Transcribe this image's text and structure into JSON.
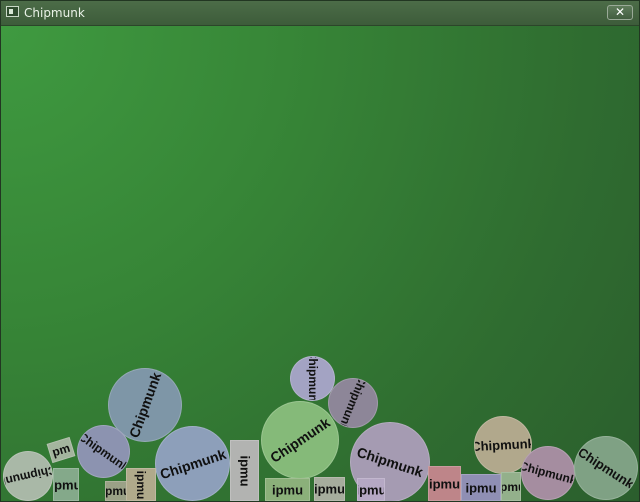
{
  "window": {
    "title": "Chipmunk",
    "close_symbol": "✕"
  },
  "scene": {
    "body_text": "Chipmunk",
    "palette": {
      "bg_top": "#3f9a40",
      "bg_bottom": "#2b5e2d"
    },
    "bodies": [
      {
        "name": "body-circle-1",
        "shape": "circle",
        "text": "Chipmunk",
        "color": "#a9b8a7"
      },
      {
        "name": "body-circle-2",
        "shape": "circle",
        "text": "Chipmunk",
        "color": "#7e96a7"
      },
      {
        "name": "body-circle-3",
        "shape": "circle",
        "text": "Chipmunk",
        "color": "#8c93b0"
      },
      {
        "name": "body-circle-4",
        "shape": "circle",
        "text": "Chipmunk",
        "color": "#8d9fba"
      },
      {
        "name": "body-circle-5",
        "shape": "circle",
        "text": "Chipmunk",
        "color": "#a3a3c3"
      },
      {
        "name": "body-circle-6",
        "shape": "circle",
        "text": "Chipmunk",
        "color": "#8d8698"
      },
      {
        "name": "body-circle-7",
        "shape": "circle",
        "text": "Chipmunk",
        "color": "#85ba79"
      },
      {
        "name": "body-circle-8",
        "shape": "circle",
        "text": "Chipmunk",
        "color": "#a59bb2"
      },
      {
        "name": "body-circle-9",
        "shape": "circle",
        "text": "Chipmunk",
        "color": "#b1a88c"
      },
      {
        "name": "body-circle-10",
        "shape": "circle",
        "text": "Chipmunk",
        "color": "#a58da0"
      },
      {
        "name": "body-circle-11",
        "shape": "circle",
        "text": "Chipmunk",
        "color": "#7fa184"
      },
      {
        "name": "body-box-1",
        "shape": "box",
        "text": "ipmu",
        "color": "#84a98a"
      },
      {
        "name": "body-box-2",
        "shape": "box",
        "text": "pm",
        "color": "#a4b59e"
      },
      {
        "name": "body-box-3",
        "shape": "box",
        "text": "ipmu",
        "color": "#9aa186"
      },
      {
        "name": "body-box-4",
        "shape": "box",
        "text": "ipmu",
        "color": "#b0aa8b"
      },
      {
        "name": "body-box-5",
        "shape": "box",
        "text": "ipmu",
        "color": "#b2b3b1"
      },
      {
        "name": "body-box-6",
        "shape": "box",
        "text": "ipmu",
        "color": "#8bb07a"
      },
      {
        "name": "body-box-7",
        "shape": "box",
        "text": "ipmu",
        "color": "#a6ad9d"
      },
      {
        "name": "body-box-8",
        "shape": "box",
        "text": "ipmu",
        "color": "#b5a8c4"
      },
      {
        "name": "body-box-9",
        "shape": "box",
        "text": "ipmu",
        "color": "#be8589"
      },
      {
        "name": "body-box-10",
        "shape": "box",
        "text": "ipmu",
        "color": "#8f8fb4"
      },
      {
        "name": "body-box-11",
        "shape": "box",
        "text": "ipmu",
        "color": "#93b08b"
      }
    ]
  }
}
